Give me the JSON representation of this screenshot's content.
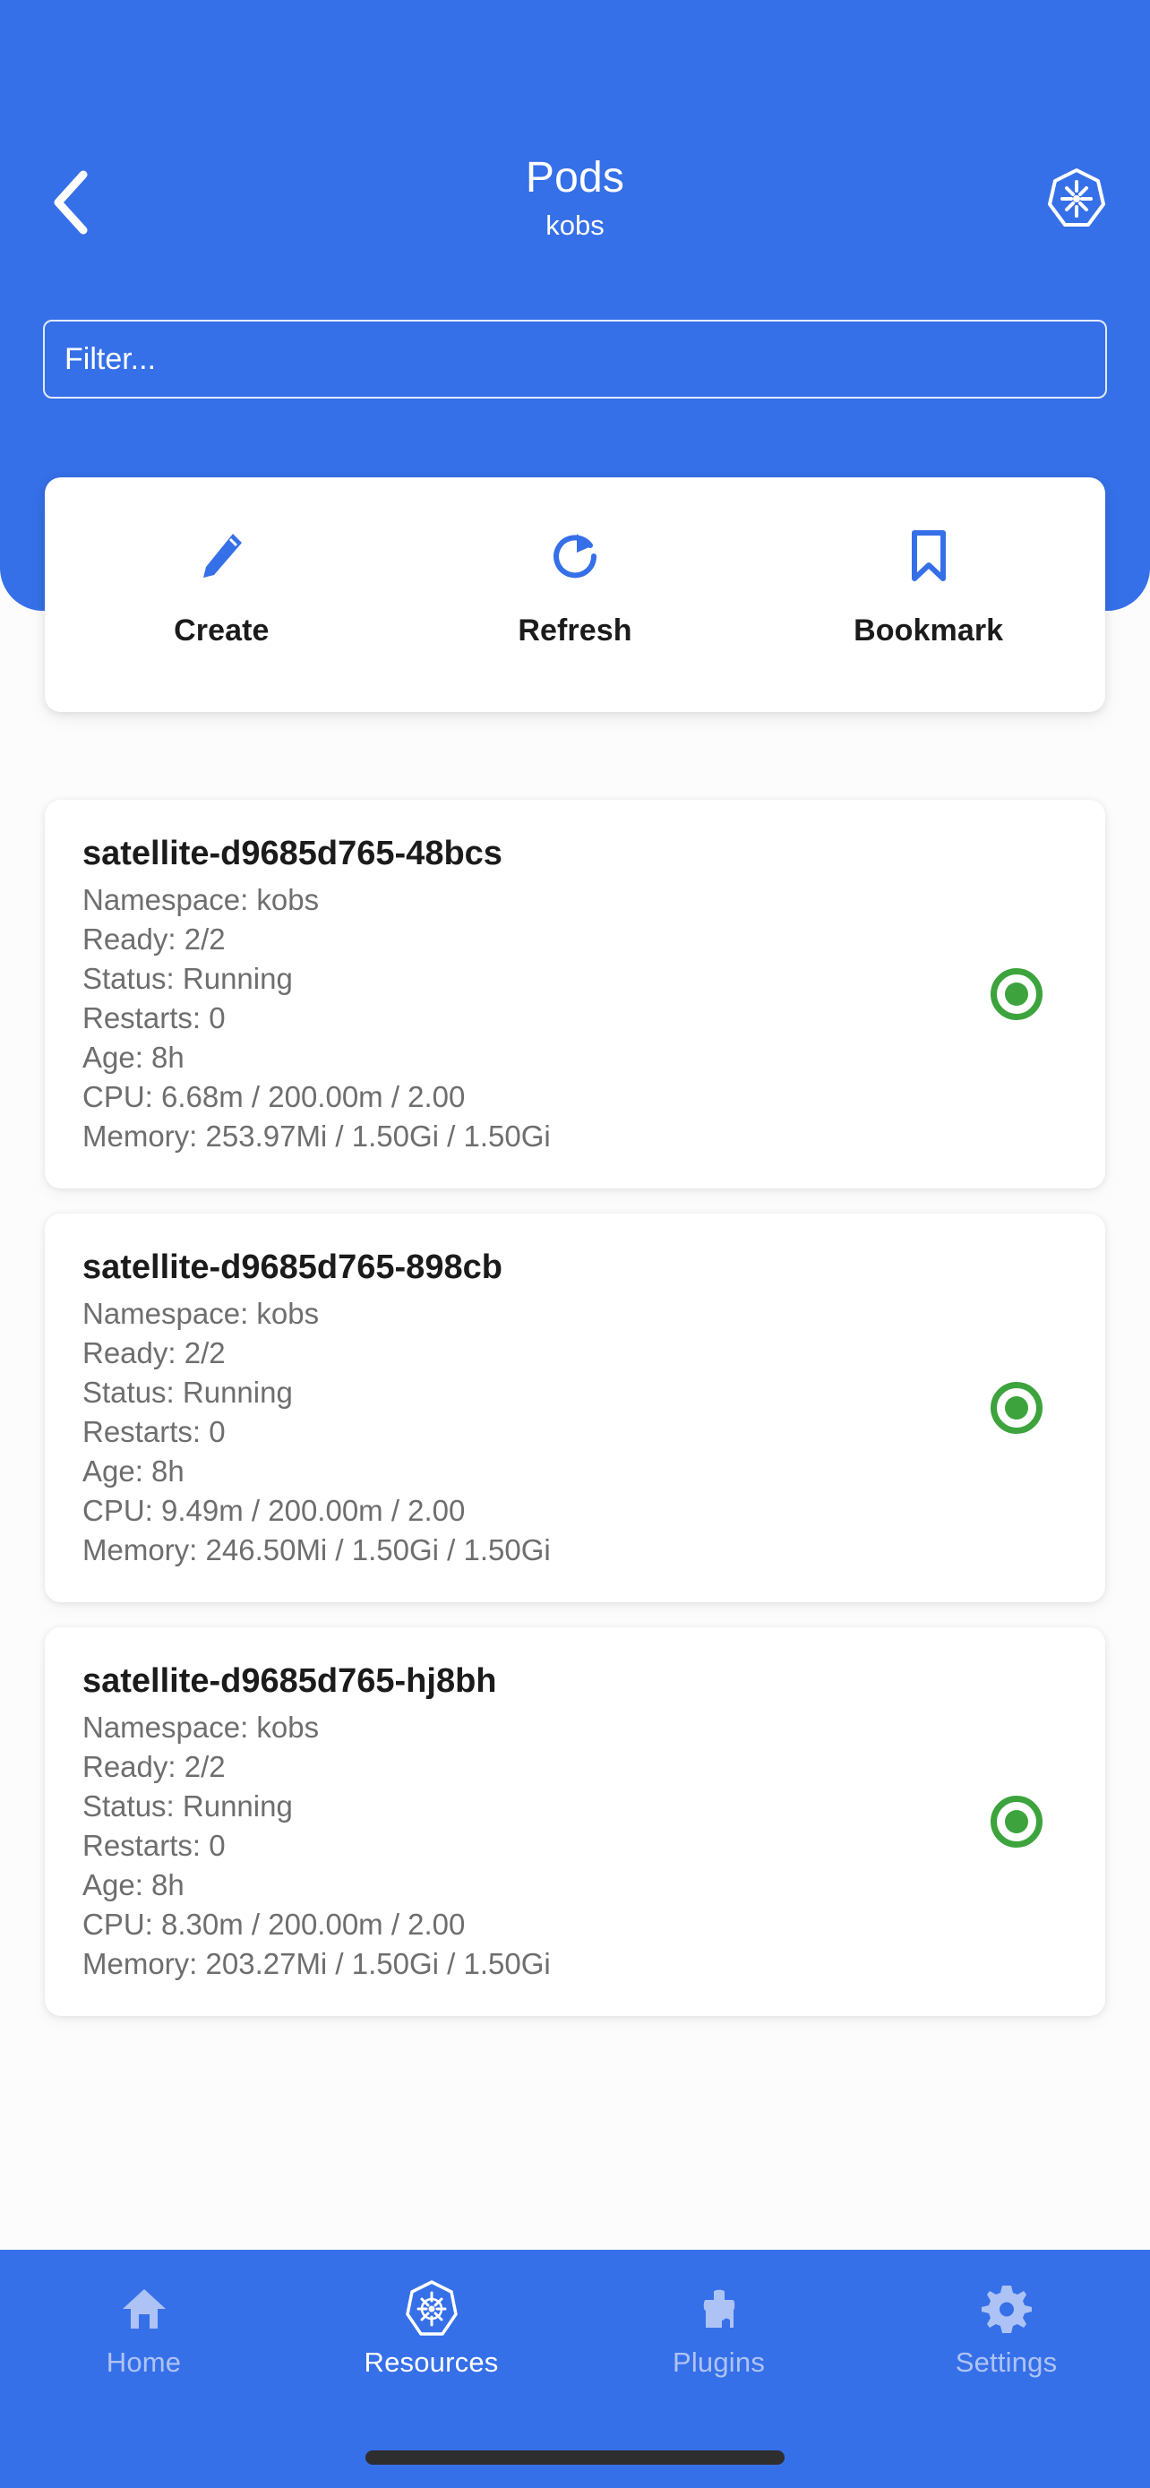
{
  "theme": {
    "primary": "#3670E8",
    "accent_green": "#3DA33D",
    "page_bg": "#FCFCFC",
    "card_bg": "#FFFFFF",
    "muted_text": "#6E6E6E",
    "nav_inactive": "#AEC3F5"
  },
  "header": {
    "title": "Pods",
    "subtitle": "kobs",
    "back_icon": "chevron-left-icon",
    "cluster_icon": "kubernetes-icon"
  },
  "filter": {
    "value": "",
    "placeholder": "Filter..."
  },
  "actions": [
    {
      "label": "Create",
      "icon": "pencil-icon"
    },
    {
      "label": "Refresh",
      "icon": "refresh-icon"
    },
    {
      "label": "Bookmark",
      "icon": "bookmark-icon"
    }
  ],
  "pods": [
    {
      "name": "satellite-d9685d765-48bcs",
      "namespace": "Namespace: kobs",
      "ready": "Ready: 2/2",
      "status": "Status: Running",
      "restarts": "Restarts: 0",
      "age": "Age: 8h",
      "cpu": "CPU: 6.68m / 200.00m / 2.00",
      "memory": "Memory: 253.97Mi / 1.50Gi / 1.50Gi",
      "status_indicator": "healthy"
    },
    {
      "name": "satellite-d9685d765-898cb",
      "namespace": "Namespace: kobs",
      "ready": "Ready: 2/2",
      "status": "Status: Running",
      "restarts": "Restarts: 0",
      "age": "Age: 8h",
      "cpu": "CPU: 9.49m / 200.00m / 2.00",
      "memory": "Memory: 246.50Mi / 1.50Gi / 1.50Gi",
      "status_indicator": "healthy"
    },
    {
      "name": "satellite-d9685d765-hj8bh",
      "namespace": "Namespace: kobs",
      "ready": "Ready: 2/2",
      "status": "Status: Running",
      "restarts": "Restarts: 0",
      "age": "Age: 8h",
      "cpu": "CPU: 8.30m / 200.00m / 2.00",
      "memory": "Memory: 203.27Mi / 1.50Gi / 1.50Gi",
      "status_indicator": "healthy"
    }
  ],
  "bottom_nav": {
    "items": [
      {
        "label": "Home",
        "icon": "home-icon",
        "active": false
      },
      {
        "label": "Resources",
        "icon": "kubernetes-icon",
        "active": true
      },
      {
        "label": "Plugins",
        "icon": "puzzle-icon",
        "active": false
      },
      {
        "label": "Settings",
        "icon": "gear-icon",
        "active": false
      }
    ]
  }
}
